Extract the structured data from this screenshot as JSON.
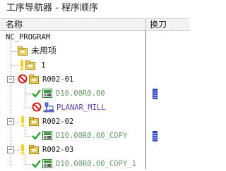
{
  "window": {
    "title": "工序导航器 - 程序顺序"
  },
  "columns": {
    "name": "名称",
    "tool_change": "换刀"
  },
  "tree": {
    "root": "NC_PROGRAM",
    "unused": "未用项",
    "program_1": "1",
    "group1": "R002-01",
    "op1": "D10.00R0.00",
    "op2": "PLANAR_MILL",
    "group2": "R002-02",
    "op3": "D10.00R0.00_COPY",
    "group3": "R002-03",
    "op4": "D10.00R0.00_COPY_1"
  },
  "colors": {
    "ok": "#2fa52f",
    "error": "#d42020",
    "folder": "#e6c64a",
    "tool": "#3a4fd0"
  }
}
